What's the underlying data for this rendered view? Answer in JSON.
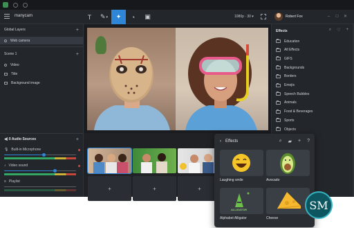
{
  "app": {
    "name": "manycam"
  },
  "toolbar": {
    "tools": [
      "text-tool",
      "pen-tool",
      "effects-tool",
      "timer-tool",
      "picture-in-picture-tool"
    ],
    "resolution": "1080p · 30"
  },
  "user": {
    "name": "Robert Fox"
  },
  "left_panel": {
    "global_layers": "Global Layers",
    "web_camera": "Web camera",
    "scene_title": "Scene 1",
    "scene_items": [
      "Video",
      "Title",
      "Background image"
    ],
    "audio_header": "0 Audio Sources",
    "audio_sources": [
      {
        "label": "Built-in Microphone",
        "level": 0.55
      },
      {
        "label": "Video sound",
        "level": 0.7
      },
      {
        "label": "Playlist",
        "level": 0.0
      }
    ]
  },
  "effects_panel": {
    "title": "Effects",
    "categories": [
      "Education",
      "All Effects",
      "GIFS",
      "Backgrounds",
      "Borders",
      "Emojis",
      "Speech Bubbles",
      "Animals",
      "Food & Beverages",
      "Sports",
      "Objects"
    ]
  },
  "thumbnails": {
    "add_label": "+"
  },
  "popup": {
    "title": "Effects",
    "items": [
      "Laughing smile",
      "Avocado",
      "Alphabet Alligator",
      "Cheese"
    ],
    "alligator_text": "ALLIGATOR"
  },
  "watermark": {
    "text": "SM"
  },
  "colors": {
    "accent": "#2f86d6",
    "panel": "#23262b",
    "bg": "#1e2024"
  }
}
